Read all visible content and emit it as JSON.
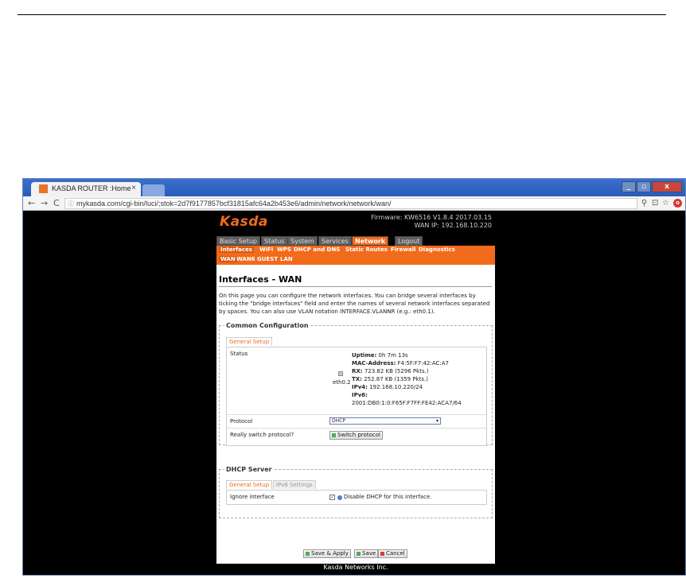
{
  "browser": {
    "tab_title": "KASDA ROUTER :Home",
    "tab_close": "×",
    "url": "mykasda.com/cgi-bin/luci/;stok=2d7f9177857bcf31815afc64a2b453e6/admin/network/network/wan/",
    "back": "←",
    "forward": "→",
    "reload": "C",
    "info": "ⓘ",
    "zoom_icon": "⚲",
    "translate_icon": "⊡",
    "star_icon": "☆",
    "opera_icon": "o",
    "win_min": "_",
    "win_max": "▫",
    "win_close": "x"
  },
  "router": {
    "logo": "Kasda",
    "firmware": "Firmware: KW6516 V1.8.4 2017.03.15",
    "wan_ip": "WAN IP: 192.168.10.220",
    "topnav": [
      "Basic Setup",
      "Status",
      "System",
      "Services",
      "Network",
      "Logout"
    ],
    "subnav1": [
      "Interfaces",
      "WiFi",
      "WPS",
      "DHCP and DNS",
      "Static Routes",
      "Firewall",
      "Diagnostics"
    ],
    "subnav2": [
      "WAN",
      "WAN6",
      "GUEST",
      "LAN"
    ]
  },
  "page": {
    "title": "Interfaces - WAN",
    "description": "On this page you can configure the network interfaces. You can bridge several interfaces by ticking the \"bridge interfaces\" field and enter the names of several network interfaces separated by spaces. You can also use VLAN notation INTERFACE.VLANNR (e.g.: eth0.1).",
    "common_config": {
      "legend": "Common Configuration",
      "tab": "General Setup",
      "status_label": "Status",
      "iface": "eth0.2",
      "uptime_k": "Uptime:",
      "uptime_v": "0h 7m 13s",
      "mac_k": "MAC-Address:",
      "mac_v": "F4:5F:F7:42:AC:A7",
      "rx_k": "RX:",
      "rx_v": "723.82 KB (5296 Pkts.)",
      "tx_k": "TX:",
      "tx_v": "252.87 KB (1359 Pkts.)",
      "ipv4_k": "IPv4:",
      "ipv4_v": "192.168.10.220/24",
      "ipv6_k": "IPv6:",
      "ipv6_v": "2001:DB0:1:0:F65F:F7FF:FE42:ACA7/64",
      "protocol_label": "Protocol",
      "protocol_value": "DHCP",
      "switch_label": "Really switch protocol?",
      "switch_button": "Switch protocol"
    },
    "dhcp_server": {
      "legend": "DHCP Server",
      "tab_general": "General Setup",
      "tab_ipv6": "IPv6 Settings",
      "ignore_label": "Ignore interface",
      "ignore_text": "Disable DHCP for this interface."
    },
    "buttons": {
      "save_apply": "Save & Apply",
      "save": "Save",
      "cancel": "Cancel"
    },
    "footer": "Kasda Networks Inc."
  }
}
